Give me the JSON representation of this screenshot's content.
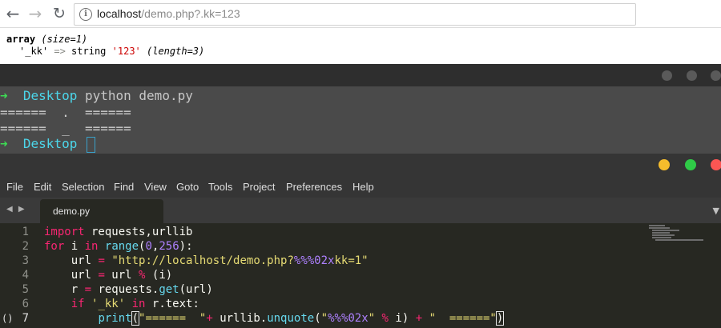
{
  "browser": {
    "url_host": "localhost",
    "url_path": "/demo.php?.kk=123",
    "info_icon": "i"
  },
  "php_output": {
    "line1_type": "array",
    "line1_size": "(size=1)",
    "key": "'_kk'",
    "arrow": "=>",
    "value_type": "string",
    "value": "'123'",
    "length": "(length=3)"
  },
  "terminal": {
    "prompt_arrow": "➜",
    "prompt_dir": "Desktop",
    "command": "python demo.py",
    "output1": "======  .  ======",
    "output2": "======  _  ======"
  },
  "editor": {
    "menu": [
      "File",
      "Edit",
      "Selection",
      "Find",
      "View",
      "Goto",
      "Tools",
      "Project",
      "Preferences",
      "Help"
    ],
    "tab_nav": "◀ ▶",
    "tab_title": "demo.py",
    "tab_dropdown": "▼",
    "fold_mark": "()",
    "line_numbers": [
      "1",
      "2",
      "3",
      "4",
      "5",
      "6",
      "7"
    ],
    "colors": {
      "keyword": "#f92672",
      "string": "#e6db74",
      "number": "#ae81ff",
      "function": "#66d9ef",
      "background": "#272822"
    },
    "code": {
      "l1_kw": "import",
      "l1_rest": " requests,urllib",
      "l2_kw": "for",
      "l2_a": " i ",
      "l2_in": "in",
      "l2_sp": " ",
      "l2_range": "range",
      "l2_p1": "(",
      "l2_n1": "0",
      "l2_c": ",",
      "l2_n2": "256",
      "l2_p2": "):",
      "l3_a": "    url ",
      "l3_eq": "=",
      "l3_sp": " ",
      "l3_s1": "\"http://localhost/demo.php?",
      "l3_fmt": "%%%02x",
      "l3_s2": "kk=1\"",
      "l4_a": "    url ",
      "l4_eq": "=",
      "l4_b": " url ",
      "l4_pct": "%",
      "l4_c": " (i)",
      "l5_a": "    r ",
      "l5_eq": "=",
      "l5_b": " requests.",
      "l5_get": "get",
      "l5_c": "(url)",
      "l6_kw": "    if",
      "l6_sp": " ",
      "l6_s": "'_kk'",
      "l6_sp2": " ",
      "l6_in": "in",
      "l6_b": " r.text:",
      "l7_indent": "        ",
      "l7_print": "print",
      "l7_open": "(",
      "l7_s1": "\"======  \"",
      "l7_plus1": "+",
      "l7_b": " urllib.",
      "l7_unq": "unquote",
      "l7_p": "(",
      "l7_s2a": "\"",
      "l7_fmt": "%%%02x",
      "l7_s2b": "\"",
      "l7_sp": " ",
      "l7_pct": "%",
      "l7_c": " i) ",
      "l7_plus2": "+",
      "l7_sp2": " ",
      "l7_s3": "\"  ======\"",
      "l7_close": ")"
    }
  }
}
